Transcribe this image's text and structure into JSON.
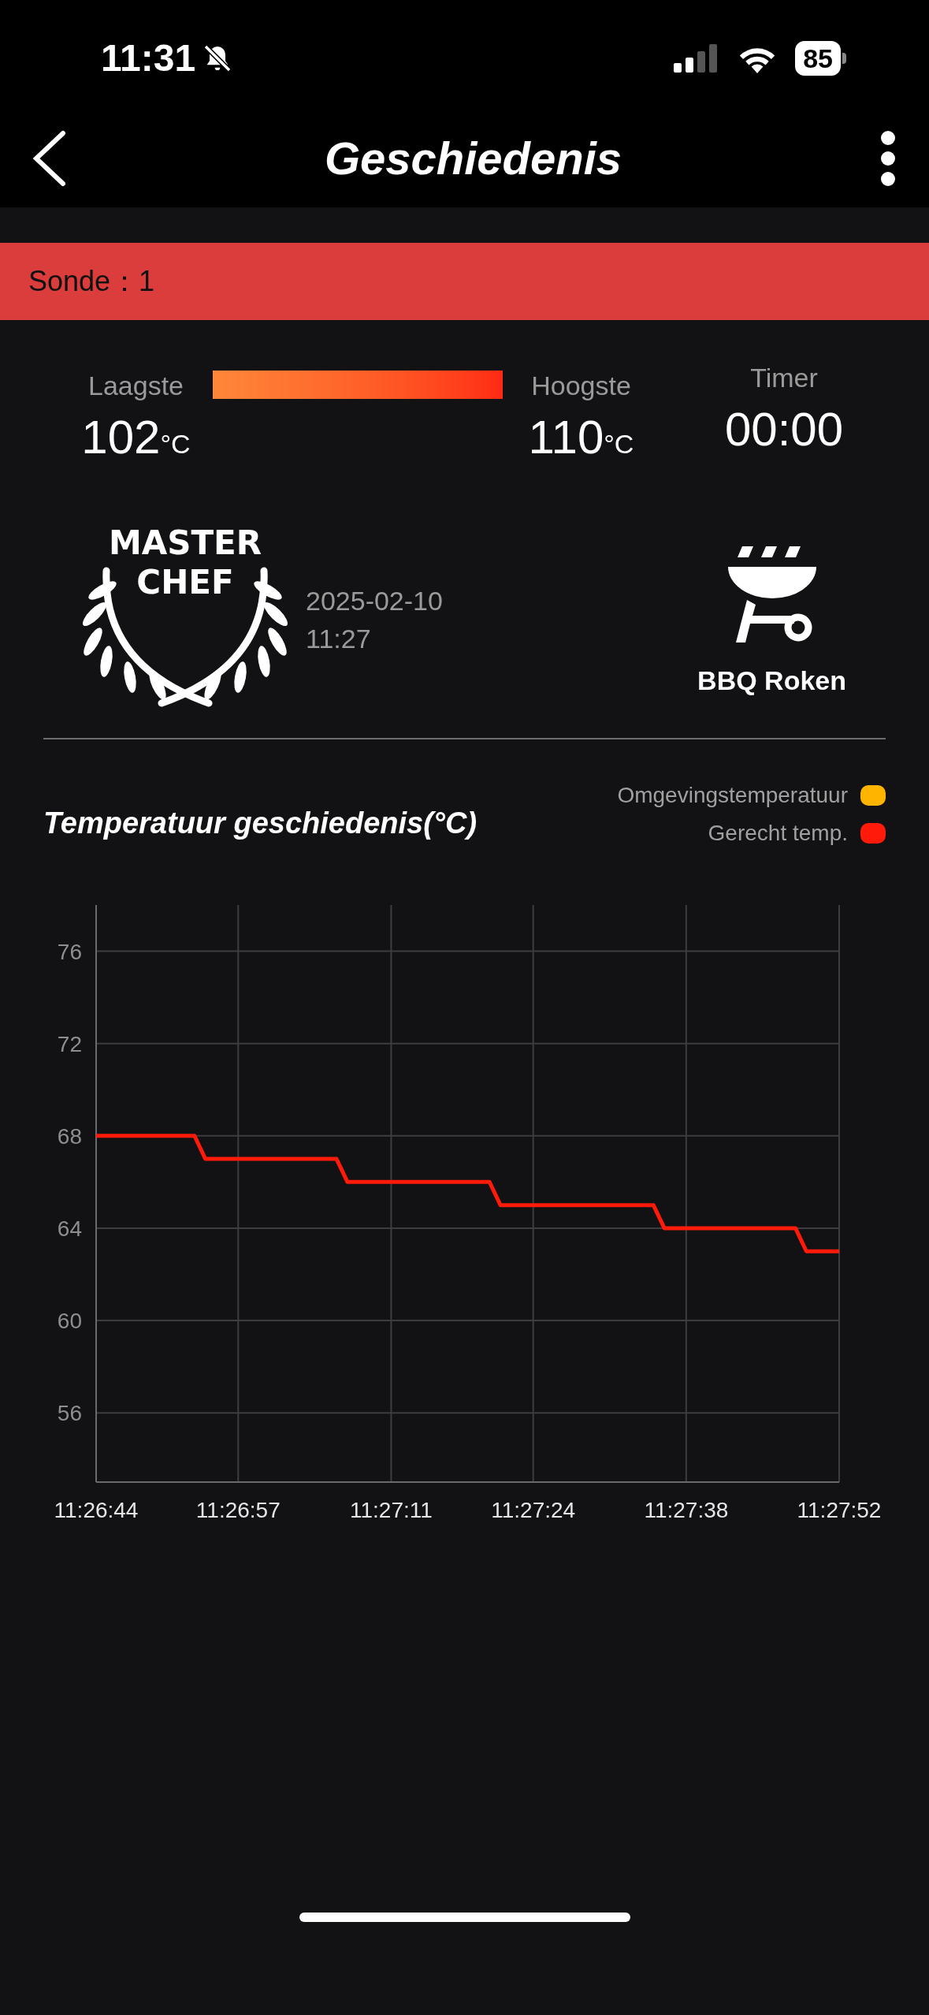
{
  "status_bar": {
    "time": "11:31",
    "battery": "85"
  },
  "header": {
    "title": "Geschiedenis"
  },
  "probe_bar": {
    "label": "Sonde：1"
  },
  "stats": [
    {
      "kind": "reading",
      "label": "Laagste",
      "value": "102",
      "unit": "°C"
    },
    {
      "kind": "reading",
      "label": "Hoogste",
      "value": "110",
      "unit": "°C"
    },
    {
      "kind": "timer",
      "label": "Timer",
      "value": "00:00"
    }
  ],
  "session": {
    "logo_lines": [
      "MASTER",
      "CHEF"
    ],
    "date": "2025-02-10",
    "time": "11:27",
    "mode": "BBQ Roken"
  },
  "chart": {
    "title": "Temperatuur geschiedenis(°C)",
    "chart_data": {
      "type": "line",
      "grid": true,
      "categories": [
        "11:26:44",
        null,
        null,
        null,
        null,
        null,
        null,
        null,
        null,
        null,
        null,
        null,
        null,
        "11:26:57",
        null,
        null,
        null,
        null,
        null,
        null,
        null,
        null,
        null,
        null,
        null,
        null,
        null,
        "11:27:11",
        null,
        null,
        null,
        null,
        null,
        null,
        null,
        null,
        null,
        null,
        null,
        null,
        "11:27:24",
        null,
        null,
        null,
        null,
        null,
        null,
        null,
        null,
        null,
        null,
        null,
        null,
        null,
        "11:27:38",
        null,
        null,
        null,
        null,
        null,
        null,
        null,
        null,
        null,
        null,
        null,
        null,
        null,
        "11:27:52"
      ],
      "series": [
        {
          "name": "Omgevingstemperatuur",
          "color": "#ffb400",
          "values": [
            null,
            null,
            null,
            null,
            null,
            null,
            null,
            null,
            null,
            null,
            null,
            null,
            null,
            null,
            null,
            null,
            null,
            null,
            null,
            null,
            null,
            null,
            null,
            null,
            null,
            null,
            null,
            null,
            null,
            null,
            null,
            null,
            null,
            null,
            null,
            null,
            null,
            null,
            null,
            null,
            null,
            null,
            null,
            null,
            null,
            null,
            null,
            null,
            null,
            null,
            null,
            null,
            null,
            null,
            null,
            null,
            null,
            null,
            null,
            null,
            null,
            null,
            null,
            null,
            null,
            null,
            null,
            null,
            null
          ]
        },
        {
          "name": "Gerecht temp.",
          "color": "#ff1a0a",
          "values": [
            68,
            68,
            68,
            68,
            68,
            68,
            68,
            68,
            68,
            68,
            67,
            67,
            67,
            67,
            67,
            67,
            67,
            67,
            67,
            67,
            67,
            67,
            67,
            66,
            66,
            66,
            66,
            66,
            66,
            66,
            66,
            66,
            66,
            66,
            66,
            66,
            66,
            65,
            65,
            65,
            65,
            65,
            65,
            65,
            65,
            65,
            65,
            65,
            65,
            65,
            65,
            65,
            64,
            64,
            64,
            64,
            64,
            64,
            64,
            64,
            64,
            64,
            64,
            64,
            64,
            63,
            63,
            63,
            63
          ]
        }
      ],
      "ylim": [
        53,
        78
      ],
      "yticks": [
        56,
        60,
        64,
        68,
        72,
        76
      ]
    }
  }
}
